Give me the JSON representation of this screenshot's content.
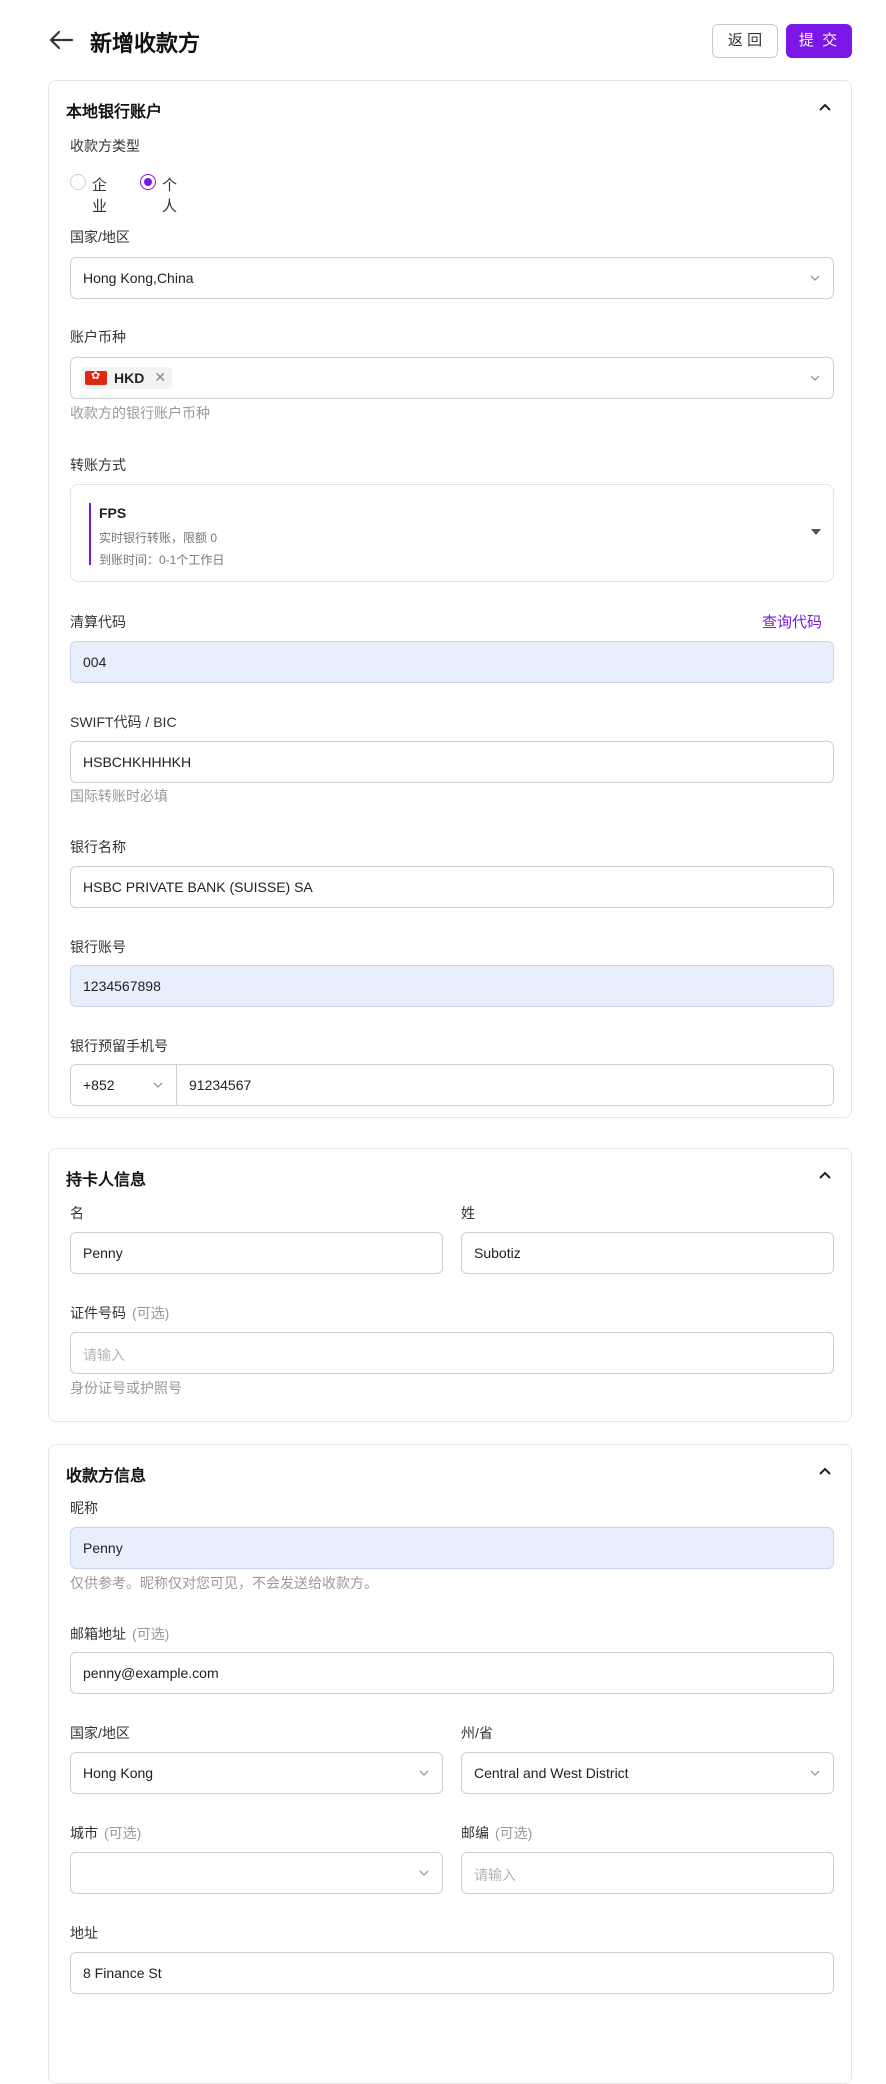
{
  "header": {
    "title": "新增收款方",
    "return_label": "返 回",
    "submit_label": "提 交",
    "back_icon": "arrow-left-icon"
  },
  "accent_color": "#7a16e6",
  "bank_section": {
    "title": "本地银行账户",
    "payee_type_label": "收款方类型",
    "payee_types": [
      {
        "label": "企业",
        "checked": false
      },
      {
        "label": "个人",
        "checked": true
      }
    ],
    "country_label": "国家/地区",
    "country_value": "Hong Kong,China",
    "currency_label": "账户币种",
    "currency_value": "HKD",
    "currency_hint": "收款方的银行账户币种",
    "transfer_method_label": "转账方式",
    "transfer_method": {
      "name": "FPS",
      "line1": "实时银行转账，限额 0",
      "line2": "到账时间：0-1个工作日"
    },
    "clearing_code_label": "清算代码",
    "query_code_link": "查询代码",
    "clearing_code_value": "004",
    "swift_label": "SWIFT代码 / BIC",
    "swift_value": "HSBCHKHHHKH",
    "swift_hint": "国际转账时必填",
    "bank_name_label": "银行名称",
    "bank_name_value": "HSBC PRIVATE BANK (SUISSE) SA",
    "account_label": "银行账号",
    "account_value": "1234567898",
    "phone_label": "银行预留手机号",
    "phone_code": "+852",
    "phone_value": "91234567"
  },
  "holder_section": {
    "title": "持卡人信息",
    "first_name_label": "名",
    "first_name_value": "Penny",
    "last_name_label": "姓",
    "last_name_value": "Subotiz",
    "id_label": "证件号码",
    "optional": "(可选)",
    "id_placeholder": "请输入",
    "id_hint": "身份证号或护照号"
  },
  "payee_section": {
    "title": "收款方信息",
    "nickname_label": "昵称",
    "nickname_value": "Penny",
    "nickname_hint": "仅供参考。昵称仅对您可见，不会发送给收款方。",
    "email_label": "邮箱地址",
    "optional": "(可选)",
    "email_value": "penny@example.com",
    "country_label": "国家/地区",
    "country_value": "Hong Kong",
    "state_label": "州/省",
    "state_value": "Central and West District",
    "city_label": "城市",
    "city_value": "",
    "zip_label": "邮编",
    "zip_placeholder": "请输入",
    "address_label": "地址",
    "address_value": "8 Finance St"
  }
}
